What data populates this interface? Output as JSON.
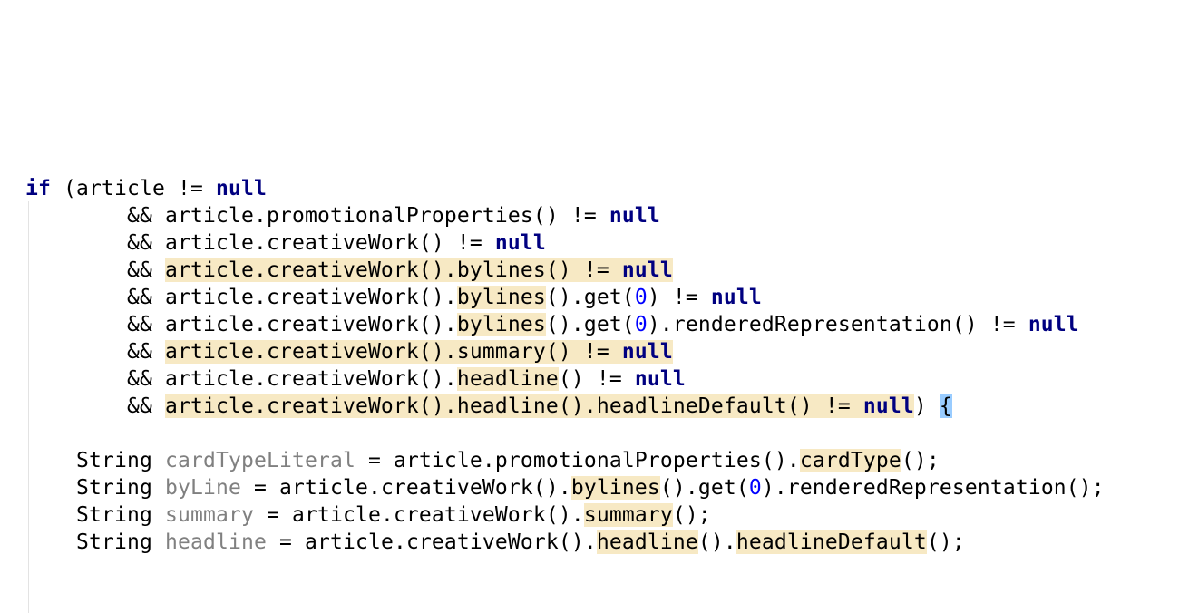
{
  "editor": {
    "lines": [
      {
        "indent": "",
        "tokens": [
          {
            "t": "if",
            "c": "kw"
          },
          {
            "t": " (article != ",
            "c": ""
          },
          {
            "t": "null",
            "c": "kw"
          }
        ]
      },
      {
        "indent": "        ",
        "tokens": [
          {
            "t": "&& article.promotionalProperties() != ",
            "c": ""
          },
          {
            "t": "null",
            "c": "kw"
          }
        ]
      },
      {
        "indent": "        ",
        "tokens": [
          {
            "t": "&& article.creativeWork() != ",
            "c": ""
          },
          {
            "t": "null",
            "c": "kw"
          }
        ]
      },
      {
        "indent": "        ",
        "tokens": [
          {
            "t": "&& ",
            "c": ""
          },
          {
            "t": "article.creativeWork().bylines() != ",
            "c": "hl"
          },
          {
            "t": "null",
            "c": "kw hl"
          }
        ]
      },
      {
        "indent": "        ",
        "tokens": [
          {
            "t": "&& article.creativeWork().",
            "c": ""
          },
          {
            "t": "bylines",
            "c": "hl"
          },
          {
            "t": "().get(",
            "c": ""
          },
          {
            "t": "0",
            "c": "num"
          },
          {
            "t": ") != ",
            "c": ""
          },
          {
            "t": "null",
            "c": "kw"
          }
        ]
      },
      {
        "indent": "        ",
        "tokens": [
          {
            "t": "&& article.creativeWork().",
            "c": ""
          },
          {
            "t": "bylines",
            "c": "hl"
          },
          {
            "t": "().get(",
            "c": ""
          },
          {
            "t": "0",
            "c": "num"
          },
          {
            "t": ").renderedRepresentation() != ",
            "c": ""
          },
          {
            "t": "null",
            "c": "kw"
          }
        ]
      },
      {
        "indent": "        ",
        "tokens": [
          {
            "t": "&& ",
            "c": ""
          },
          {
            "t": "article.creativeWork().summary() != ",
            "c": "hl"
          },
          {
            "t": "null",
            "c": "kw hl"
          }
        ]
      },
      {
        "indent": "        ",
        "tokens": [
          {
            "t": "&& article.creativeWork().",
            "c": ""
          },
          {
            "t": "headline",
            "c": "hl"
          },
          {
            "t": "() != ",
            "c": ""
          },
          {
            "t": "null",
            "c": "kw"
          }
        ]
      },
      {
        "indent": "        ",
        "tokens": [
          {
            "t": "&& ",
            "c": ""
          },
          {
            "t": "article.creativeWork().headline().headlineDefault() != ",
            "c": "hl"
          },
          {
            "t": "null",
            "c": "kw hl"
          },
          {
            "t": ") ",
            "c": ""
          },
          {
            "t": "{",
            "c": "brace"
          }
        ]
      },
      {
        "indent": "",
        "tokens": []
      },
      {
        "indent": "    ",
        "tokens": [
          {
            "t": "String ",
            "c": ""
          },
          {
            "t": "cardTypeLiteral",
            "c": "var"
          },
          {
            "t": " = article.promotionalProperties().",
            "c": ""
          },
          {
            "t": "cardType",
            "c": "hl"
          },
          {
            "t": "();",
            "c": ""
          }
        ]
      },
      {
        "indent": "    ",
        "tokens": [
          {
            "t": "String ",
            "c": ""
          },
          {
            "t": "byLine",
            "c": "var"
          },
          {
            "t": " = article.creativeWork().",
            "c": ""
          },
          {
            "t": "bylines",
            "c": "hl"
          },
          {
            "t": "().get(",
            "c": ""
          },
          {
            "t": "0",
            "c": "num"
          },
          {
            "t": ").renderedRepresentation();",
            "c": ""
          }
        ]
      },
      {
        "indent": "    ",
        "tokens": [
          {
            "t": "String ",
            "c": ""
          },
          {
            "t": "summary",
            "c": "var"
          },
          {
            "t": " = article.creativeWork().",
            "c": ""
          },
          {
            "t": "summary",
            "c": "hl"
          },
          {
            "t": "();",
            "c": ""
          }
        ]
      },
      {
        "indent": "    ",
        "tokens": [
          {
            "t": "String ",
            "c": ""
          },
          {
            "t": "headline",
            "c": "var"
          },
          {
            "t": " = article.creativeWork().",
            "c": ""
          },
          {
            "t": "headline",
            "c": "hl"
          },
          {
            "t": "().",
            "c": ""
          },
          {
            "t": "headlineDefault",
            "c": "hl"
          },
          {
            "t": "();",
            "c": ""
          }
        ]
      }
    ]
  },
  "colors": {
    "keyword": "#000080",
    "number": "#0000ff",
    "unused_variable": "#808080",
    "usage_highlight": "#f7e9c4",
    "brace_match": "#99ccff",
    "text": "#000000",
    "background": "#ffffff"
  }
}
